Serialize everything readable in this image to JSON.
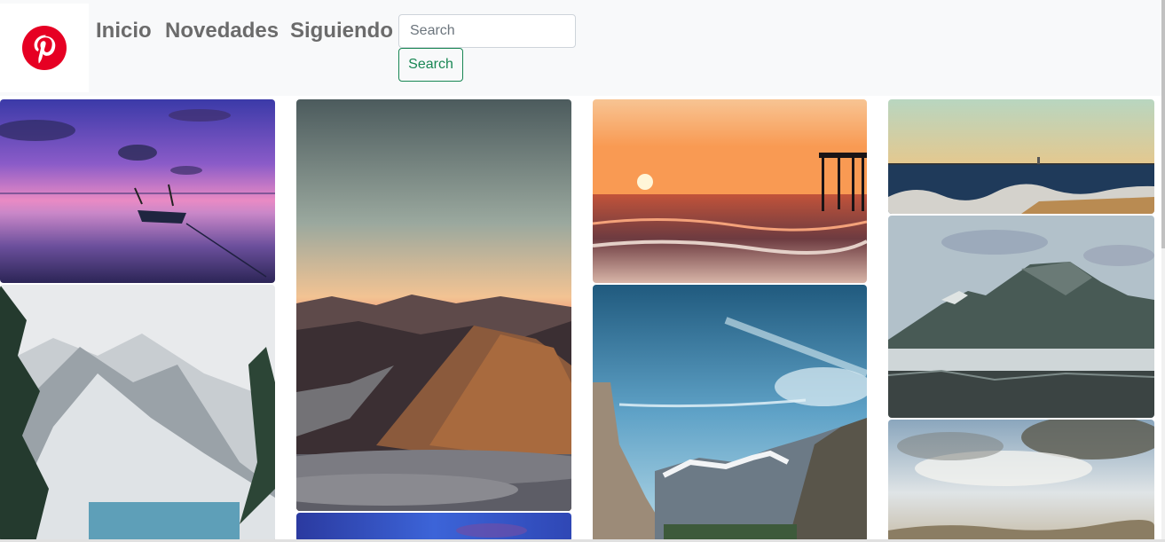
{
  "brand": {
    "logo_icon": "pinterest-logo-icon",
    "logo_text": "P",
    "logo_color": "#e60023"
  },
  "nav": {
    "links": [
      {
        "label": "Inicio"
      },
      {
        "label": "Novedades"
      },
      {
        "label": "Siguiendo"
      }
    ],
    "link_color": "#6b6b6b"
  },
  "search": {
    "placeholder": "Search",
    "value": "",
    "button_label": "Search",
    "button_color": "#198754"
  },
  "pins": [
    {
      "name": "pin-sunset-boat-lake",
      "scene": "purple sunset over lake with rowboat"
    },
    {
      "name": "pin-snowy-mountain-lake",
      "scene": "snowy mountains with frosted pines and lake"
    },
    {
      "name": "pin-mountain-sea-of-clouds",
      "scene": "dusk mountains above sea of clouds"
    },
    {
      "name": "pin-blue-dusk-cropped",
      "scene": "blue dusk sky (cropped)"
    },
    {
      "name": "pin-beach-sunset-pier",
      "scene": "orange beach sunset with pier"
    },
    {
      "name": "pin-yosemite-valley",
      "scene": "yosemite valley cliffs and blue sky"
    },
    {
      "name": "pin-lighthouse-rocky-shore",
      "scene": "lighthouse on horizon with rocky shore"
    },
    {
      "name": "pin-misty-mountain-lake",
      "scene": "misty mountain reflected in lake"
    },
    {
      "name": "pin-cloudy-sky-hills",
      "scene": "cloudy sky over distant hills"
    }
  ]
}
